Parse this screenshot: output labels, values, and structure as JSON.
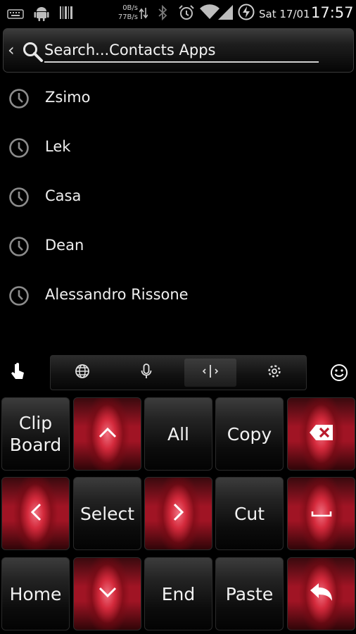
{
  "status_bar": {
    "rate_down": "0B/s",
    "rate_up": "77B/s",
    "date": "Sat 17/01",
    "time": "17:57",
    "icons": [
      "keyboard-icon",
      "android-icon",
      "barcode-icon",
      "data-arrows-icon",
      "bluetooth-icon",
      "alarm-icon",
      "wifi-icon",
      "signal-icon",
      "power-icon"
    ]
  },
  "search": {
    "placeholder": "Search...Contacts Apps",
    "value": ""
  },
  "history": [
    {
      "label": "Zsimo"
    },
    {
      "label": "Lek"
    },
    {
      "label": "Casa"
    },
    {
      "label": "Dean"
    },
    {
      "label": "Alessandro Rissone"
    }
  ],
  "keyboard": {
    "toolbar": [
      "hand-pointer-icon",
      "globe-icon",
      "microphone-icon",
      "cursor-icon",
      "settings-icon",
      "smiley-icon"
    ],
    "rows": [
      [
        "Clip\nBoard",
        "up-arrow-icon",
        "All",
        "Copy",
        "backspace-icon"
      ],
      [
        "left-arrow-icon",
        "Select",
        "right-arrow-icon",
        "Cut",
        "space-icon"
      ],
      [
        "Home",
        "down-arrow-icon",
        "End",
        "Paste",
        "enter-icon"
      ]
    ],
    "labels": {
      "clipboard": "Clip\nBoard",
      "all": "All",
      "copy": "Copy",
      "select": "Select",
      "cut": "Cut",
      "home": "Home",
      "end": "End",
      "paste": "Paste"
    },
    "accent_red": "#d42a3c"
  }
}
